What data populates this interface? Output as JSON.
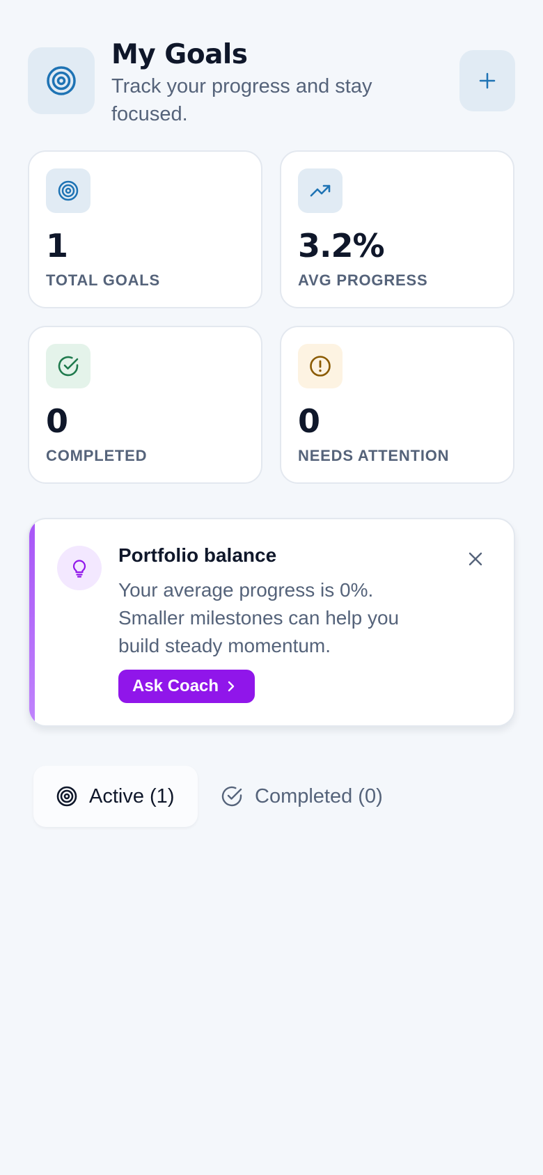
{
  "header": {
    "title": "My Goals",
    "subtitle": "Track your progress and stay focused.",
    "icon": "target-icon",
    "add_icon": "plus-icon"
  },
  "stats": [
    {
      "icon": "target-icon",
      "value": "1",
      "label": "TOTAL GOALS"
    },
    {
      "icon": "trending-up-icon",
      "value": "3.2%",
      "label": "AVG PROGRESS"
    },
    {
      "icon": "check-circle-icon",
      "value": "0",
      "label": "COMPLETED"
    },
    {
      "icon": "alert-circle-icon",
      "value": "0",
      "label": "NEEDS ATTENTION"
    }
  ],
  "insight": {
    "icon": "lightbulb-icon",
    "title": "Portfolio balance",
    "body": "Your average progress is 0%. Smaller milestones can help you build steady momentum.",
    "button_label": "Ask Coach",
    "close_icon": "close-icon"
  },
  "tabs": [
    {
      "label": "Active (1)",
      "icon": "target-icon",
      "active": true
    },
    {
      "label": "Completed (0)",
      "icon": "check-circle-icon",
      "active": false
    }
  ],
  "colors": {
    "accent_blue": "#1e73b4",
    "accent_purple": "#9016ea",
    "success_green": "#1f7a4d",
    "warning_brown": "#8a5a00",
    "background": "#f4f7fb"
  }
}
